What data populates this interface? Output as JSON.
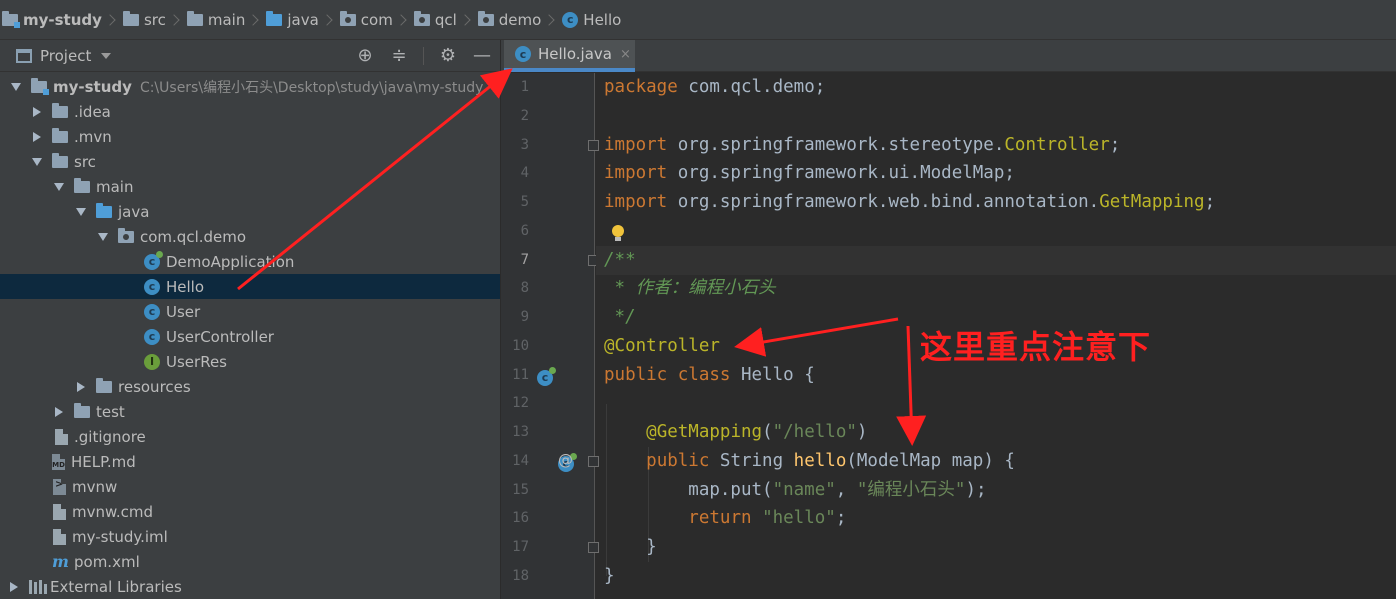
{
  "breadcrumb": [
    {
      "label": "my-study",
      "icon": "module-folder-icon"
    },
    {
      "label": "src",
      "icon": "folder-icon"
    },
    {
      "label": "main",
      "icon": "folder-icon"
    },
    {
      "label": "java",
      "icon": "source-folder-icon"
    },
    {
      "label": "com",
      "icon": "package-icon"
    },
    {
      "label": "qcl",
      "icon": "package-icon"
    },
    {
      "label": "demo",
      "icon": "package-icon"
    },
    {
      "label": "Hello",
      "icon": "class-icon"
    }
  ],
  "project_panel": {
    "title": "Project",
    "tools": [
      "locate-icon",
      "collapse-icon",
      "gear-icon",
      "hide-icon"
    ]
  },
  "tree": [
    {
      "label": "my-study",
      "path": "C:\\Users\\编程小石头\\Desktop\\study\\java\\my-study",
      "icon": "module-folder-icon"
    },
    {
      "label": ".idea",
      "icon": "folder-icon"
    },
    {
      "label": ".mvn",
      "icon": "folder-icon"
    },
    {
      "label": "src",
      "icon": "folder-icon"
    },
    {
      "label": "main",
      "icon": "folder-icon"
    },
    {
      "label": "java",
      "icon": "source-folder-icon"
    },
    {
      "label": "com.qcl.demo",
      "icon": "package-icon"
    },
    {
      "label": "DemoApplication",
      "icon": "spring-boot-class-icon"
    },
    {
      "label": "Hello",
      "icon": "class-icon"
    },
    {
      "label": "User",
      "icon": "class-icon"
    },
    {
      "label": "UserController",
      "icon": "class-icon"
    },
    {
      "label": "UserRes",
      "icon": "interface-icon"
    },
    {
      "label": "resources",
      "icon": "resources-folder-icon"
    },
    {
      "label": "test",
      "icon": "folder-icon"
    },
    {
      "label": ".gitignore",
      "icon": "file-icon"
    },
    {
      "label": "HELP.md",
      "icon": "markdown-file-icon"
    },
    {
      "label": "mvnw",
      "icon": "script-file-icon"
    },
    {
      "label": "mvnw.cmd",
      "icon": "file-icon"
    },
    {
      "label": "my-study.iml",
      "icon": "file-icon"
    },
    {
      "label": "pom.xml",
      "icon": "maven-icon"
    },
    {
      "label": "External Libraries",
      "icon": "libraries-icon"
    }
  ],
  "editor": {
    "tab": {
      "label": "Hello.java",
      "close": "×"
    },
    "line_numbers": [
      "1",
      "2",
      "3",
      "4",
      "5",
      "6",
      "7",
      "8",
      "9",
      "10",
      "11",
      "12",
      "13",
      "14",
      "15",
      "16",
      "17",
      "18"
    ]
  },
  "annotation": {
    "text": "这里重点注意下",
    "color": "#ff2020"
  },
  "colors": {
    "keyword": "#cc7832",
    "annotation": "#bbb529",
    "string": "#6a8759",
    "doc_comment": "#629755",
    "method": "#ffc66d",
    "selection": "#0d293e"
  }
}
